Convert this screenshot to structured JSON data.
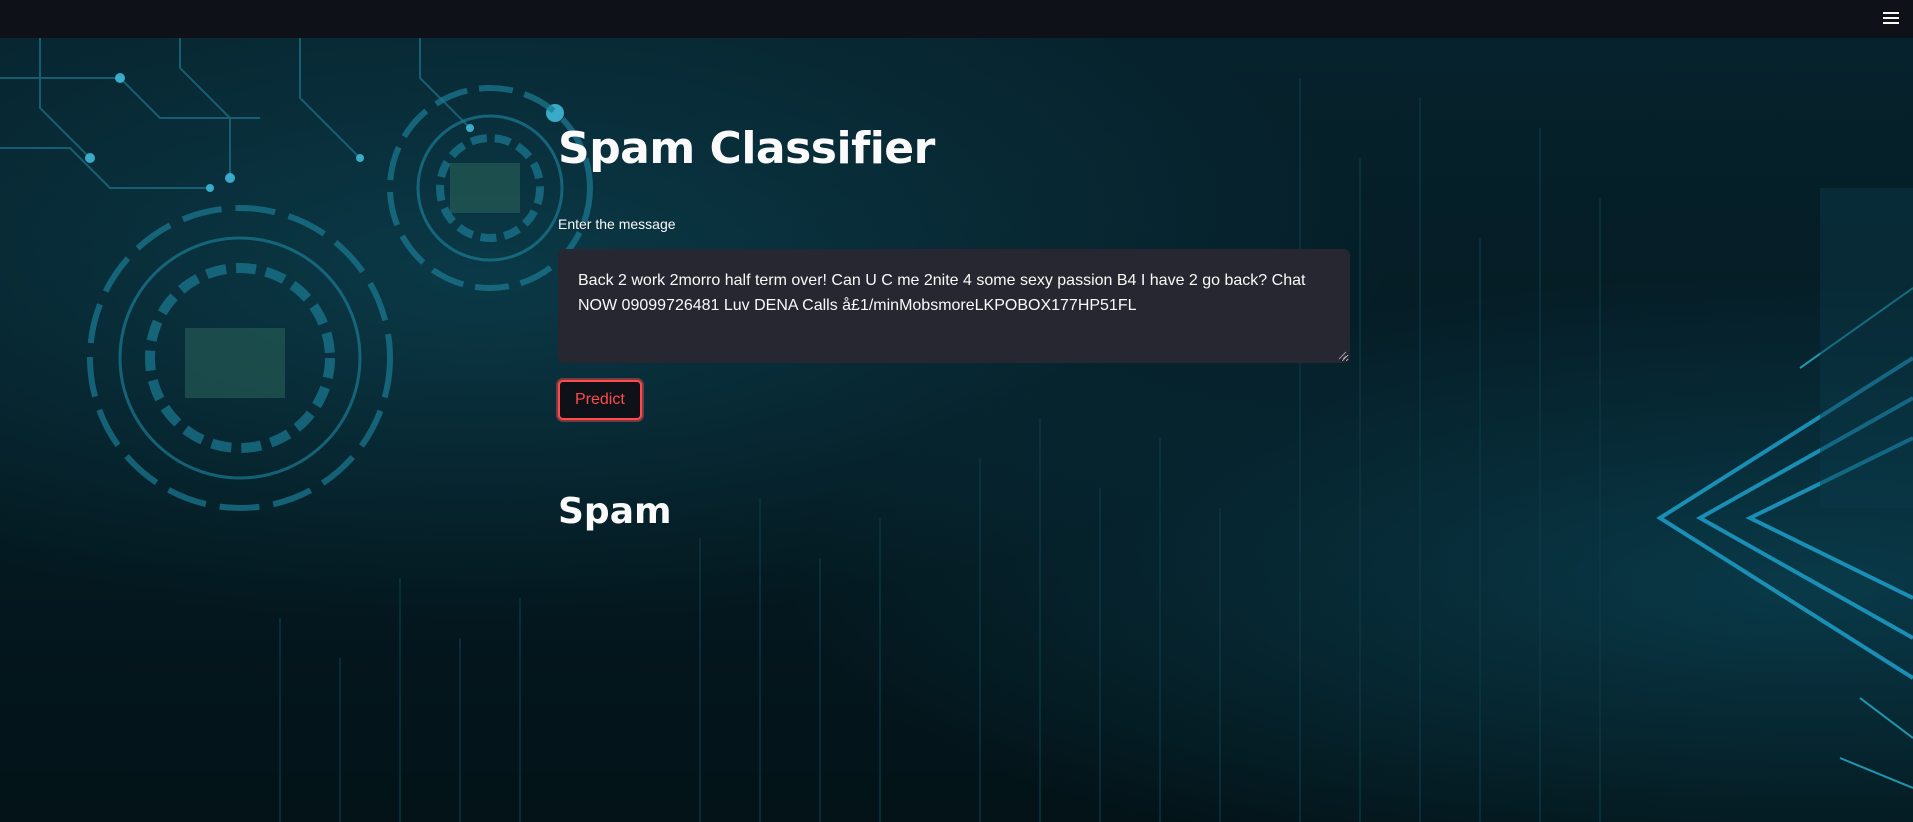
{
  "header": {
    "menu_icon": "hamburger-menu-icon"
  },
  "background": {
    "theme": "dark cyber circuit",
    "accent": "#1fb8d8"
  },
  "main": {
    "title": "Spam Classifier",
    "input": {
      "label": "Enter the message",
      "value": "Back 2 work 2morro half term over! Can U C me 2nite 4 some sexy passion B4 I have 2 go back? Chat NOW 09099726481 Luv DENA Calls å£1/minMobsmoreLKPOBOX177HP51FL"
    },
    "predict_button": "Predict",
    "result": "Spam"
  },
  "colors": {
    "topbar": "#0e1117",
    "input_bg": "#262730",
    "primary": "#ff4b4b",
    "text": "#fafafa"
  }
}
